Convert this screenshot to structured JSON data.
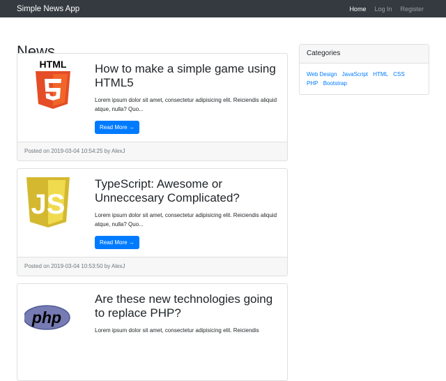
{
  "navbar": {
    "brand": "Simple News App",
    "links": [
      {
        "label": "Home",
        "active": true
      },
      {
        "label": "Log In",
        "active": false
      },
      {
        "label": "Register",
        "active": false
      }
    ]
  },
  "page_title": "News",
  "sidebar": {
    "title": "Categories",
    "categories": [
      "Web Design",
      "JavaScript",
      "HTML",
      "CSS",
      "PHP",
      "Bootstrap"
    ]
  },
  "posts": [
    {
      "icon": "html5-logo-icon",
      "title": "How to make a simple game using HTML5",
      "excerpt": "Lorem ipsum dolor sit amet, consectetur adipisicing elit. Reiciendis aliquid atque, nulla? Quo...",
      "button_label": "Read More →",
      "footer": "Posted on 2019-03-04 10:54:25 by AlexJ"
    },
    {
      "icon": "javascript-logo-icon",
      "title": "TypeScript: Awesome or Unneccesary Complicated?",
      "excerpt": "Lorem ipsum dolor sit amet, consectetur adipisicing elit. Reiciendis aliquid atque, nulla? Quo...",
      "button_label": "Read More →",
      "footer": "Posted on 2019-03-04 10:53:50 by AlexJ"
    },
    {
      "icon": "php-logo-icon",
      "title": "Are these new technologies going to replace PHP?",
      "excerpt": "Lorem ipsum dolor sit amet, consectetur adipisicing elit. Reiciendis",
      "button_label": "",
      "footer": ""
    }
  ],
  "colors": {
    "navbar_bg": "#343a40",
    "primary": "#007bff",
    "html5_orange": "#e44d26",
    "js_yellow": "#f0db4f",
    "php_purple": "#777bb3"
  }
}
